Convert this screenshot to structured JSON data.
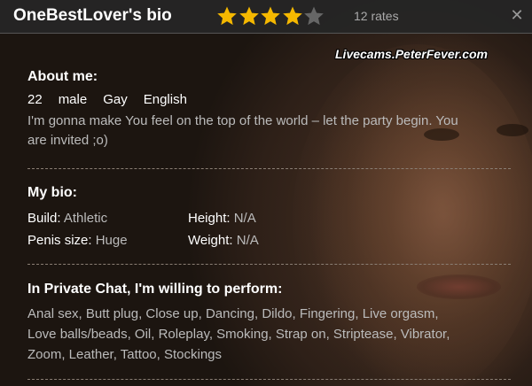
{
  "header": {
    "title": "OneBestLover's bio",
    "rating": {
      "filled": 4,
      "total": 5
    },
    "rates_text": "12 rates",
    "close_icon": "close-icon"
  },
  "watermark": "Livecams.PeterFever.com",
  "about": {
    "heading": "About me:",
    "age": "22",
    "gender": "male",
    "orientation": "Gay",
    "language": "English",
    "description": "I'm gonna make You feel on the top of the world – let the party begin. You are invited ;o)"
  },
  "bio": {
    "heading": "My bio:",
    "build_label": "Build:",
    "build_value": "Athletic",
    "height_label": "Height:",
    "height_value": "N/A",
    "penis_label": "Penis size:",
    "penis_value": "Huge",
    "weight_label": "Weight:",
    "weight_value": "N/A"
  },
  "perform": {
    "heading": "In Private Chat, I'm willing to perform:",
    "list": "Anal sex, Butt plug, Close up, Dancing, Dildo, Fingering, Live orgasm, Love balls/beads, Oil, Roleplay, Smoking, Strap on, Striptease, Vibrator, Zoom, Leather, Tattoo, Stockings"
  },
  "colors": {
    "star_filled": "#f5b800",
    "star_empty": "#666666",
    "title_bar": "#262626"
  }
}
